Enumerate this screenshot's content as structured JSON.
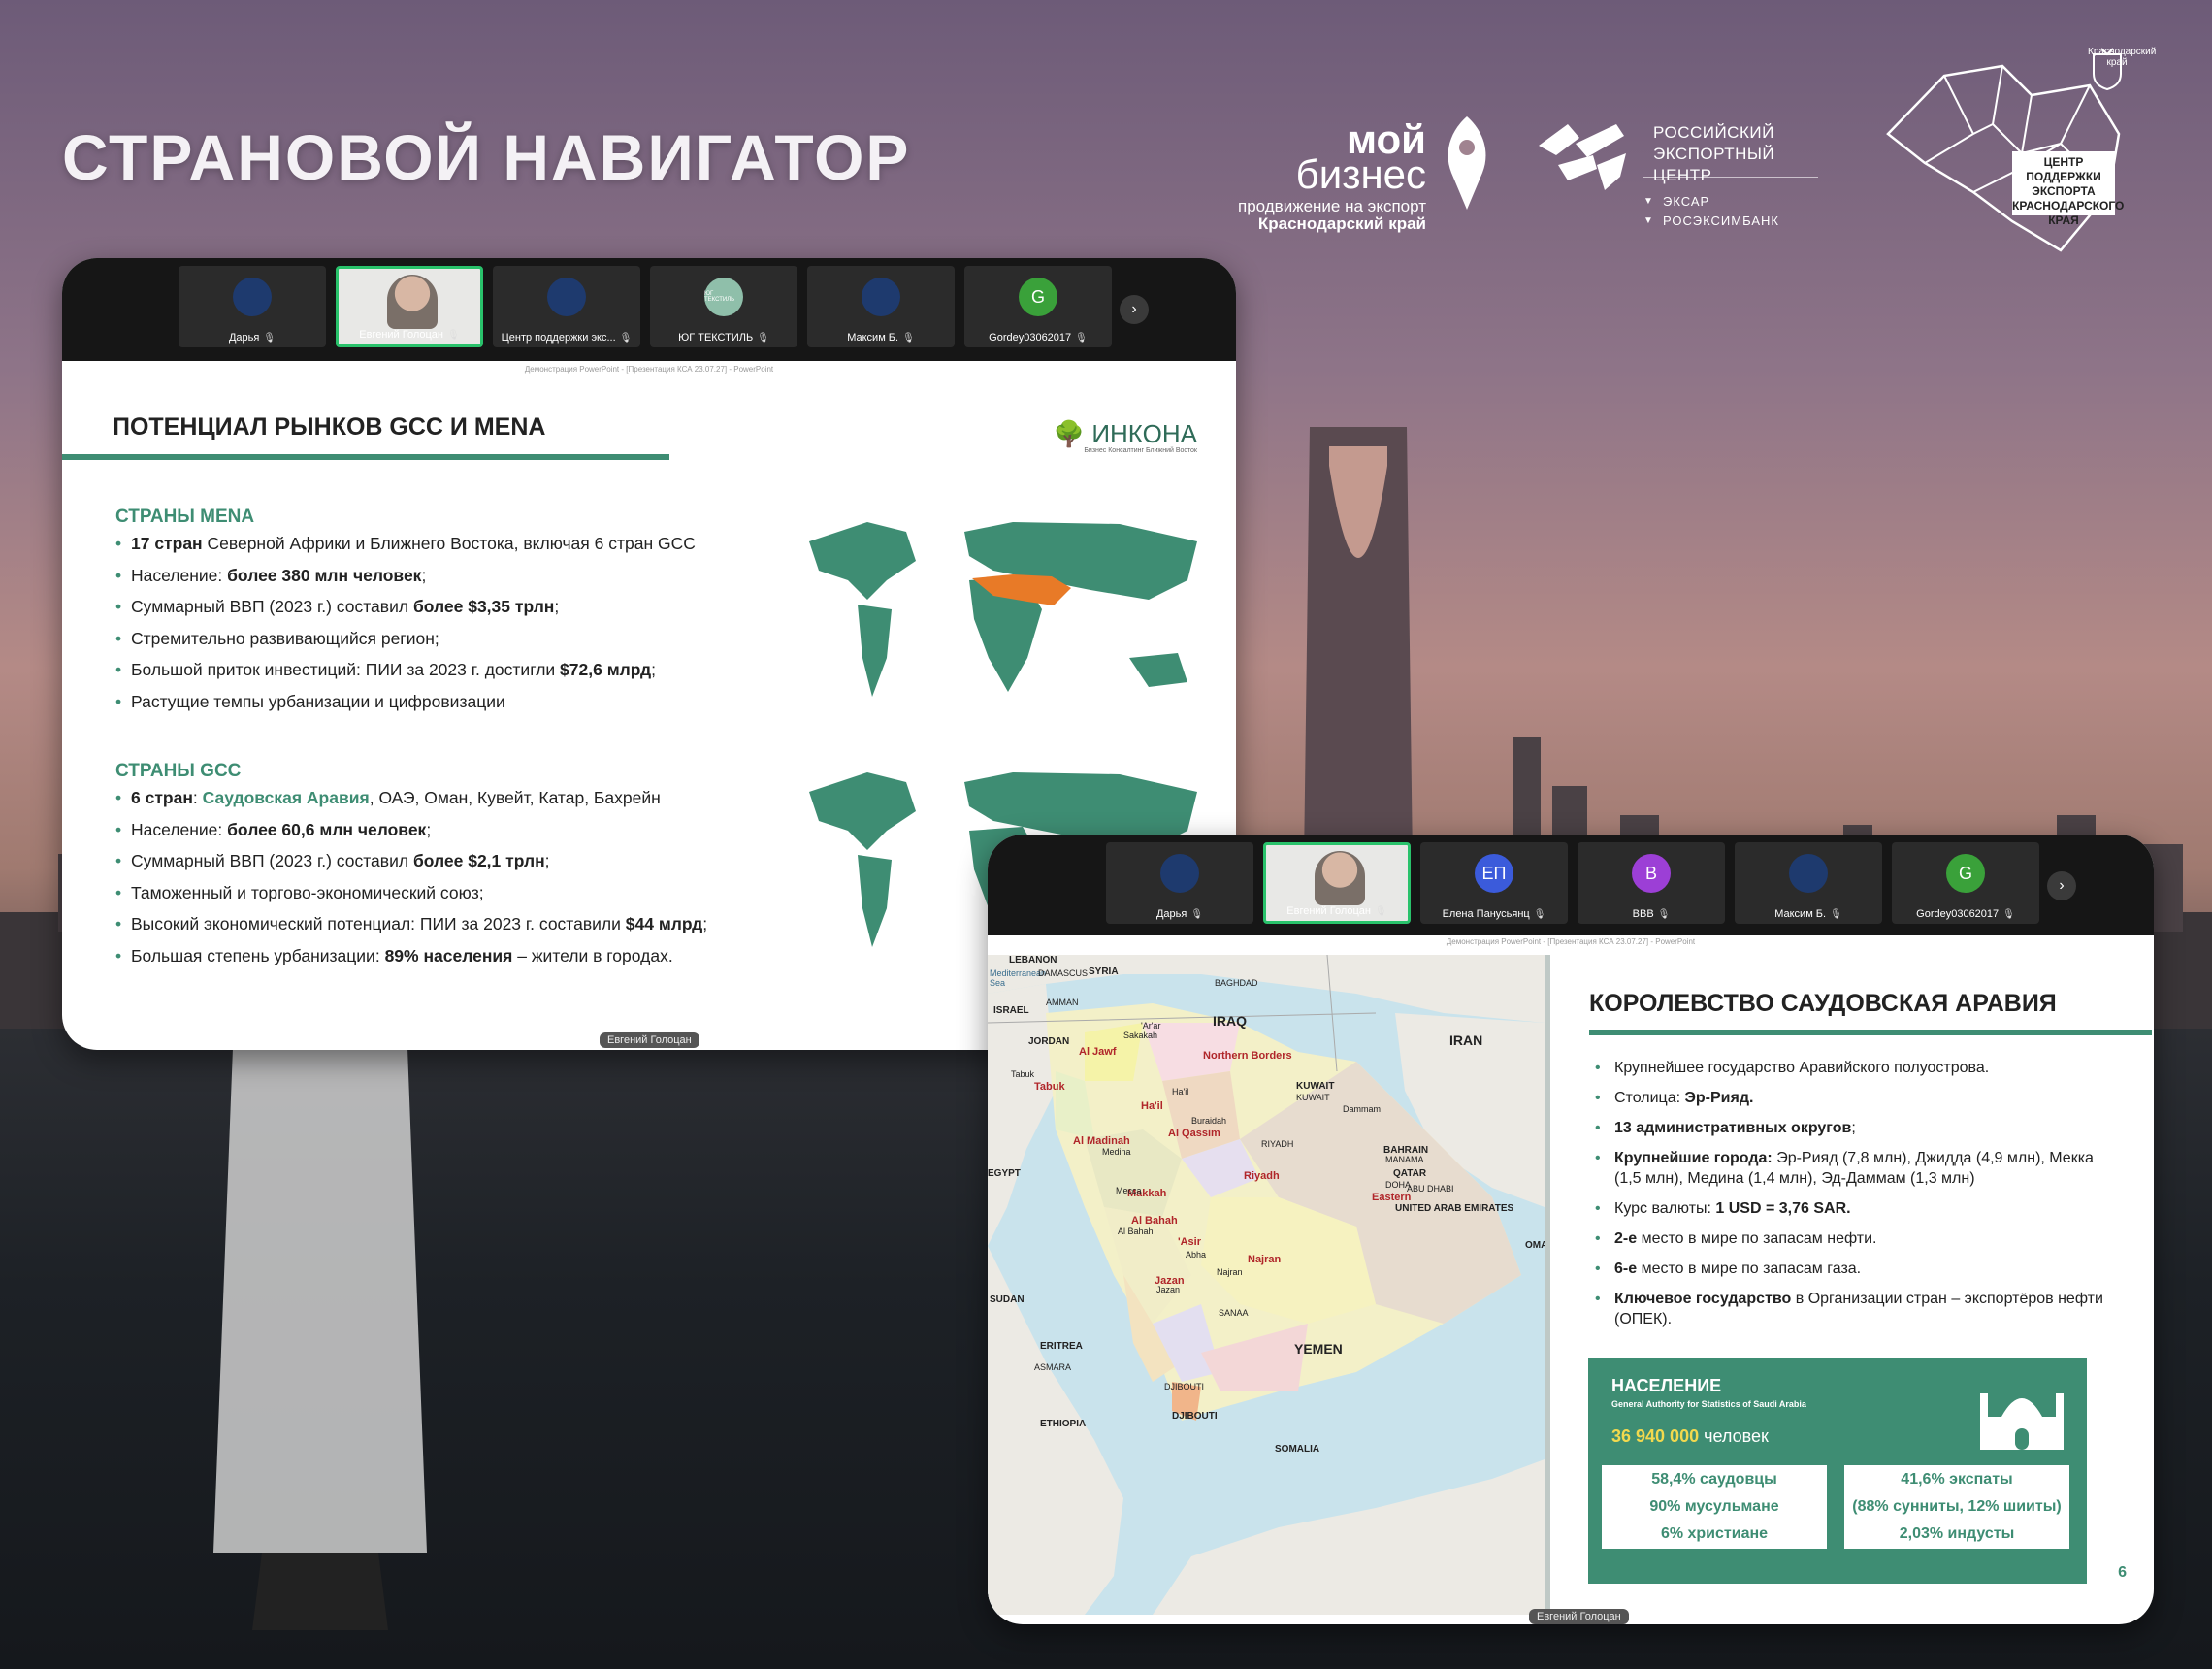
{
  "page": {
    "title": "СТРАНОВОЙ НАВИГАТОР",
    "logo_moy_biznes": {
      "line1": "мой",
      "line2": "бизнес",
      "sub1": "продвижение на экспорт",
      "sub2": "Краснодарский край"
    },
    "logo_rec": {
      "line1": "РОССИЙСКИЙ",
      "line2": "ЭКСПОРТНЫЙ ЦЕНТР",
      "sub1": "ЭКСАР",
      "sub2": "РОСЭКСИМБАНК"
    },
    "logo_center": {
      "line1": "ЦЕНТР ПОДДЕРЖКИ",
      "line2": "ЭКСПОРТА",
      "line3": "КРАСНОДАРСКОГО КРАЯ",
      "crest": "Краснодарский край"
    }
  },
  "window1": {
    "participants": [
      {
        "name": "Дарья",
        "avatar": "",
        "color": "#1e3a6e"
      },
      {
        "name": "Евгений Голоцан",
        "avatar": "",
        "color": ""
      },
      {
        "name": "Центр поддержки экс...",
        "avatar": "",
        "color": "#1e3a6e"
      },
      {
        "name": "ЮГ ТЕКСТИЛЬ",
        "avatar": "ЮГ ТЕКСТИЛЬ",
        "color": "#8fbfaa"
      },
      {
        "name": "Максим Б.",
        "avatar": "",
        "color": "#1e3a6e"
      },
      {
        "name": "Gordey03062017",
        "avatar": "G",
        "color": "#3aa13a"
      }
    ],
    "ppt_caption": "Демонстрация PowerPoint - [Презентация КСА 23.07.27] - PowerPoint",
    "speaker": "Евгений Голоцан",
    "slide": {
      "title": "ПОТЕНЦИАЛ РЫНКОВ GCC И MENA",
      "brand": "ИНКОНА",
      "brand_sub": "Бизнес Консалтинг Ближний Восток",
      "mena_heading": "СТРАНЫ MENA",
      "mena": [
        {
          "b": "17 стран",
          "t": " Северной Африки и Ближнего Востока, включая 6 стран GCC"
        },
        {
          "t": "Население: ",
          "b": "более 380 млн человек",
          "t2": ";"
        },
        {
          "t": "Суммарный ВВП (2023 г.) составил ",
          "b": "более $3,35 трлн",
          "t2": ";"
        },
        {
          "t": "Стремительно развивающийся регион;"
        },
        {
          "t": "Большой приток инвестиций: ПИИ за 2023 г. достигли ",
          "b": "$72,6 млрд",
          "t2": ";"
        },
        {
          "t": "Растущие темпы урбанизации и цифровизации"
        }
      ],
      "gcc_heading": "СТРАНЫ GCC",
      "gcc": [
        {
          "b": "6 стран",
          "t": ": ",
          "g": "Саудовская Аравия",
          "t2": ", ОАЭ, Оман, Кувейт, Катар, Бахрейн"
        },
        {
          "t": "Население: ",
          "b": "более 60,6 млн человек",
          "t2": ";"
        },
        {
          "t": "Суммарный ВВП (2023 г.) составил ",
          "b": "более $2,1 трлн",
          "t2": ";"
        },
        {
          "t": "Таможенный и торгово-экономический союз;"
        },
        {
          "t": "Высокий экономический потенциал: ПИИ за 2023 г. составили ",
          "b": "$44 млрд",
          "t2": ";"
        },
        {
          "t": "Большая степень урбанизации: ",
          "b": "89% населения",
          "t2": " – жители в городах."
        }
      ]
    }
  },
  "window2": {
    "participants": [
      {
        "name": "Дарья",
        "avatar": "",
        "color": "#1e3a6e"
      },
      {
        "name": "Евгений Голоцан",
        "avatar": "",
        "color": ""
      },
      {
        "name": "Елена Панусьянц",
        "avatar": "ЕП",
        "color": "#3b5bdb"
      },
      {
        "name": "ВВВ",
        "avatar": "В",
        "color": "#9c3fd6"
      },
      {
        "name": "Максим Б.",
        "avatar": "",
        "color": "#1e3a6e"
      },
      {
        "name": "Gordey03062017",
        "avatar": "G",
        "color": "#3aa13a"
      }
    ],
    "ppt_caption": "Демонстрация PowerPoint - [Презентация КСА 23.07.27] - PowerPoint",
    "speaker": "Евгений Голоцан",
    "map_labels": {
      "countries": [
        "LEBANON",
        "SYRIA",
        "ISRAEL",
        "JORDAN",
        "IRAQ",
        "IRAN",
        "KUWAIT",
        "BAHRAIN",
        "QATAR",
        "UNITED ARAB EMIRATES",
        "OMA",
        "YEMEN",
        "SUDAN",
        "ERITREA",
        "ETHIOPIA",
        "DJIBOUTI",
        "SOMALIA",
        "EGYPT"
      ],
      "sea": "Mediterranean Sea",
      "regions": [
        "Al Jawf",
        "Northern Borders",
        "Tabuk",
        "Ha'il",
        "Al Qassim",
        "Al Madinah",
        "Riyadh",
        "Eastern",
        "Makkah",
        "Al Bahah",
        "'Asir",
        "Najran",
        "Jazan"
      ],
      "cities": [
        "DAMASCUS",
        "AMMAN",
        "BAGHDAD",
        "KUWAIT",
        "Sakakah",
        "'Ar'ar",
        "Tabuk",
        "Ha'il",
        "Buraidah",
        "RIYADH",
        "Dammam",
        "MANAMA",
        "DOHA",
        "ABU DHABI",
        "Medina",
        "Mecca",
        "Al Bahah",
        "Abha",
        "Najran",
        "Jazan",
        "ASMARA",
        "SANAA",
        "DJIBOUTI"
      ]
    },
    "slide": {
      "title": "КОРОЛЕВСТВО САУДОВСКАЯ АРАВИЯ",
      "facts": [
        {
          "t": "Крупнейшее государство Аравийского полуострова."
        },
        {
          "t": "Столица: ",
          "b": "Эр-Рияд."
        },
        {
          "b": "13 административных округов",
          "t2": ";"
        },
        {
          "b": "Крупнейшие города:",
          "t2": " Эр-Рияд (7,8 млн), Джидда (4,9 млн), Мекка (1,5 млн), Медина (1,4 млн), Эд-Даммам (1,3 млн)"
        },
        {
          "t": "Курс валюты: ",
          "b": "1 USD = 3,76 SAR."
        },
        {
          "b": "2-е",
          "t2": " место в мире по запасам нефти."
        },
        {
          "b": "6-е",
          "t2": " место в мире по запасам газа."
        },
        {
          "b": "Ключевое государство",
          "t2": " в Организации стран – экспортёров нефти (ОПЕК)."
        }
      ],
      "population": {
        "heading": "НАСЕЛЕНИЕ",
        "source": "General Authority for Statistics of Saudi Arabia",
        "value": "36 940 000",
        "unit": " человек",
        "pills": [
          "58,4% саудовцы",
          "41,6% экспаты",
          "90% мусульмане",
          "(88% сунниты, 12% шииты)",
          "6% христиане",
          "2,03% индусты"
        ]
      },
      "page_number": "6"
    }
  }
}
